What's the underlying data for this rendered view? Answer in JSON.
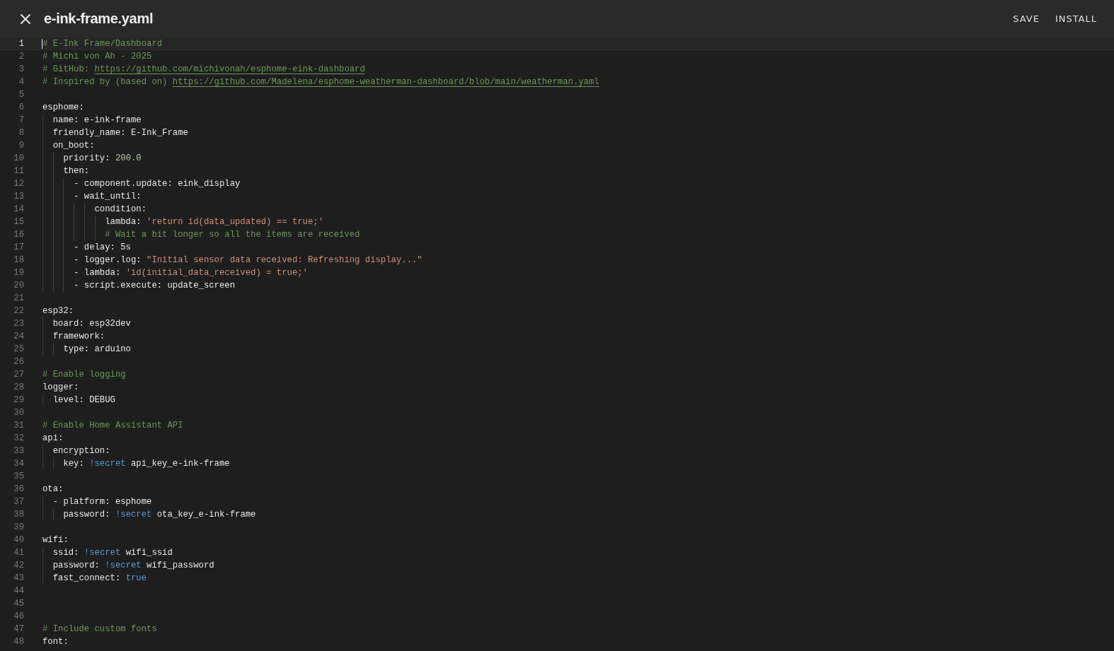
{
  "header": {
    "title": "e-ink-frame.yaml",
    "buttons": [
      "SAVE",
      "INSTALL"
    ]
  },
  "editor": {
    "lines": [
      {
        "number": "1",
        "current": true,
        "tokens": [
          {
            "kind": "comment",
            "text": "# E-Ink Frame/Dashboard"
          }
        ]
      },
      {
        "number": "2",
        "current": false,
        "tokens": [
          {
            "kind": "comment",
            "text": "# Michi von Ah - 2025"
          }
        ]
      },
      {
        "number": "3",
        "current": false,
        "tokens": [
          {
            "kind": "comment",
            "text": "# GitHub: "
          },
          {
            "kind": "link",
            "text": "https://github.com/michivonah/esphome-eink-dashboard"
          }
        ]
      },
      {
        "number": "4",
        "current": false,
        "tokens": [
          {
            "kind": "comment",
            "text": "# Inspired by (based on) "
          },
          {
            "kind": "link",
            "text": "https://github.com/Madelena/esphome-weatherman-dashboard/blob/main/weatherman.yaml"
          }
        ]
      },
      {
        "number": "5",
        "current": false
      },
      {
        "number": "6",
        "current": false,
        "tokens": [
          {
            "kind": "plain",
            "text": "esphome:"
          }
        ]
      },
      {
        "number": "7",
        "current": false,
        "tokens": [
          {
            "kind": "plain",
            "text": "  name: e-ink-frame"
          }
        ]
      },
      {
        "number": "8",
        "current": false,
        "tokens": [
          {
            "kind": "plain",
            "text": "  friendly_name: E-Ink_Frame"
          }
        ]
      },
      {
        "number": "9",
        "current": false,
        "tokens": [
          {
            "kind": "plain",
            "text": "  on_boot:"
          }
        ]
      },
      {
        "number": "10",
        "current": false,
        "tokens": [
          {
            "kind": "plain",
            "text": "    priority: "
          },
          {
            "kind": "number",
            "text": "200.0"
          }
        ]
      },
      {
        "number": "11",
        "current": false,
        "tokens": [
          {
            "kind": "plain",
            "text": "    then:"
          }
        ]
      },
      {
        "number": "12",
        "current": false,
        "tokens": [
          {
            "kind": "plain",
            "text": "      - component.update: eink_display"
          }
        ]
      },
      {
        "number": "13",
        "current": false,
        "tokens": [
          {
            "kind": "plain",
            "text": "      - wait_until:"
          }
        ]
      },
      {
        "number": "14",
        "current": false,
        "tokens": [
          {
            "kind": "plain",
            "text": "          condition:"
          }
        ]
      },
      {
        "number": "15",
        "current": false,
        "tokens": [
          {
            "kind": "plain",
            "text": "            lambda: "
          },
          {
            "kind": "string",
            "text": "'return id(data_updated) == true;'"
          }
        ]
      },
      {
        "number": "16",
        "current": false,
        "tokens": [
          {
            "kind": "comment",
            "text": "            # Wait a bit longer so all the items are received"
          }
        ]
      },
      {
        "number": "17",
        "current": false,
        "tokens": [
          {
            "kind": "plain",
            "text": "      - delay: 5s"
          }
        ]
      },
      {
        "number": "18",
        "current": false,
        "tokens": [
          {
            "kind": "plain",
            "text": "      - logger.log: "
          },
          {
            "kind": "string",
            "text": "\"Initial sensor data received: Refreshing display...\""
          }
        ]
      },
      {
        "number": "19",
        "current": false,
        "tokens": [
          {
            "kind": "plain",
            "text": "      - lambda: "
          },
          {
            "kind": "string",
            "text": "'id(initial_data_received) = true;'"
          }
        ]
      },
      {
        "number": "20",
        "current": false,
        "tokens": [
          {
            "kind": "plain",
            "text": "      - script.execute: update_screen"
          }
        ]
      },
      {
        "number": "21",
        "current": false
      },
      {
        "number": "22",
        "current": false,
        "tokens": [
          {
            "kind": "plain",
            "text": "esp32:"
          }
        ]
      },
      {
        "number": "23",
        "current": false,
        "tokens": [
          {
            "kind": "plain",
            "text": "  board: esp32dev"
          }
        ]
      },
      {
        "number": "24",
        "current": false,
        "tokens": [
          {
            "kind": "plain",
            "text": "  framework:"
          }
        ]
      },
      {
        "number": "25",
        "current": false,
        "tokens": [
          {
            "kind": "plain",
            "text": "    type: arduino"
          }
        ]
      },
      {
        "number": "26",
        "current": false
      },
      {
        "number": "27",
        "current": false,
        "tokens": [
          {
            "kind": "comment",
            "text": "# Enable logging"
          }
        ]
      },
      {
        "number": "28",
        "current": false,
        "tokens": [
          {
            "kind": "plain",
            "text": "logger:"
          }
        ]
      },
      {
        "number": "29",
        "current": false,
        "tokens": [
          {
            "kind": "plain",
            "text": "  level: DEBUG"
          }
        ]
      },
      {
        "number": "30",
        "current": false
      },
      {
        "number": "31",
        "current": false,
        "tokens": [
          {
            "kind": "comment",
            "text": "# Enable Home Assistant API"
          }
        ]
      },
      {
        "number": "32",
        "current": false,
        "tokens": [
          {
            "kind": "plain",
            "text": "api:"
          }
        ]
      },
      {
        "number": "33",
        "current": false,
        "tokens": [
          {
            "kind": "plain",
            "text": "  encryption:"
          }
        ]
      },
      {
        "number": "34",
        "current": false,
        "tokens": [
          {
            "kind": "plain",
            "text": "    key: "
          },
          {
            "kind": "tag",
            "text": "!secret"
          },
          {
            "kind": "plain",
            "text": " api_key_e-ink-frame"
          }
        ]
      },
      {
        "number": "35",
        "current": false
      },
      {
        "number": "36",
        "current": false,
        "tokens": [
          {
            "kind": "plain",
            "text": "ota:"
          }
        ]
      },
      {
        "number": "37",
        "current": false,
        "tokens": [
          {
            "kind": "plain",
            "text": "  - platform: esphome"
          }
        ]
      },
      {
        "number": "38",
        "current": false,
        "tokens": [
          {
            "kind": "plain",
            "text": "    password: "
          },
          {
            "kind": "tag",
            "text": "!secret"
          },
          {
            "kind": "plain",
            "text": " ota_key_e-ink-frame"
          }
        ]
      },
      {
        "number": "39",
        "current": false
      },
      {
        "number": "40",
        "current": false,
        "tokens": [
          {
            "kind": "plain",
            "text": "wifi:"
          }
        ]
      },
      {
        "number": "41",
        "current": false,
        "tokens": [
          {
            "kind": "plain",
            "text": "  ssid: "
          },
          {
            "kind": "tag",
            "text": "!secret"
          },
          {
            "kind": "plain",
            "text": " wifi_ssid"
          }
        ]
      },
      {
        "number": "42",
        "current": false,
        "tokens": [
          {
            "kind": "plain",
            "text": "  password: "
          },
          {
            "kind": "tag",
            "text": "!secret"
          },
          {
            "kind": "plain",
            "text": " wifi_password"
          }
        ]
      },
      {
        "number": "43",
        "current": false,
        "tokens": [
          {
            "kind": "plain",
            "text": "  fast_connect: "
          },
          {
            "kind": "bool",
            "text": "true"
          }
        ]
      },
      {
        "number": "44",
        "current": false
      },
      {
        "number": "45",
        "current": false
      },
      {
        "number": "46",
        "current": false
      },
      {
        "number": "47",
        "current": false,
        "tokens": [
          {
            "kind": "comment",
            "text": "# Include custom fonts"
          }
        ]
      },
      {
        "number": "48",
        "current": false,
        "tokens": [
          {
            "kind": "plain",
            "text": "font:"
          }
        ]
      }
    ]
  }
}
